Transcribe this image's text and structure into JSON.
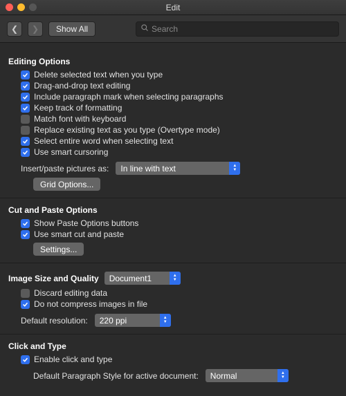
{
  "window": {
    "title": "Edit"
  },
  "toolbar": {
    "show_all": "Show All",
    "search_placeholder": "Search"
  },
  "editing": {
    "title": "Editing Options",
    "items": [
      {
        "checked": true,
        "label": "Delete selected text when you type"
      },
      {
        "checked": true,
        "label": "Drag-and-drop text editing"
      },
      {
        "checked": true,
        "label": "Include paragraph mark when selecting paragraphs"
      },
      {
        "checked": true,
        "label": "Keep track of formatting"
      },
      {
        "checked": false,
        "label": "Match font with keyboard"
      },
      {
        "checked": false,
        "label": "Replace existing text as you type (Overtype mode)"
      },
      {
        "checked": true,
        "label": "Select entire word when selecting text"
      },
      {
        "checked": true,
        "label": "Use smart cursoring"
      }
    ],
    "insert_label": "Insert/paste pictures as:",
    "insert_value": "In line with text",
    "grid_options": "Grid Options..."
  },
  "cut_paste": {
    "title": "Cut and Paste Options",
    "items": [
      {
        "checked": true,
        "label": "Show Paste Options buttons"
      },
      {
        "checked": true,
        "label": "Use smart cut and paste"
      }
    ],
    "settings": "Settings..."
  },
  "image_quality": {
    "title": "Image Size and Quality",
    "doc_value": "Document1",
    "items": [
      {
        "checked": false,
        "label": "Discard editing data"
      },
      {
        "checked": true,
        "label": "Do not compress images in file"
      }
    ],
    "res_label": "Default resolution:",
    "res_value": "220 ppi"
  },
  "click_type": {
    "title": "Click and Type",
    "items": [
      {
        "checked": true,
        "label": "Enable click and type"
      }
    ],
    "para_label": "Default Paragraph Style for active document:",
    "para_value": "Normal"
  }
}
